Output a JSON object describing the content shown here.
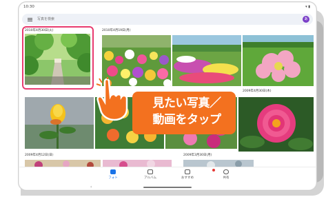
{
  "status": {
    "time": "10:30",
    "signal": "▾ ▮"
  },
  "search": {
    "placeholder": "写真を検索"
  },
  "account": {
    "initial": "あ"
  },
  "sections": {
    "d1": "2010年4月30日(火)",
    "d2": "2010年4月19日(月)",
    "d3": "2009年4月30日(木)",
    "d4": "2009年4月12日(日)",
    "d5": "2009年3月30日(月)"
  },
  "callout": {
    "line1": "見たい写真／",
    "line2": "動画をタップ"
  },
  "nav": {
    "photos": "フォト",
    "albums": "アルバム",
    "foryou": "おすすめ",
    "sharing": "共有",
    "back": "‹"
  },
  "colors": {
    "highlight": "#e83a6e",
    "callout": "#f3711f",
    "nav_active": "#1a73e8",
    "avatar": "#7b3fc8"
  }
}
